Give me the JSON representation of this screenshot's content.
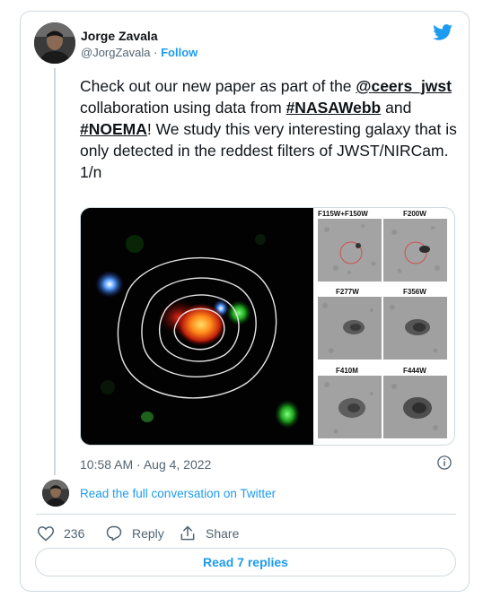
{
  "author": {
    "name": "Jorge Zavala",
    "handle": "@JorgZavala",
    "separator": "·",
    "follow_label": "Follow"
  },
  "tweet": {
    "text_1": "Check out our new paper as part of the ",
    "mention": "@ceers_jwst",
    "text_2": " collaboration using data from ",
    "hashtag_1": "#NASAWebb",
    "text_3": " and ",
    "hashtag_2": "#NOEMA",
    "text_4": "! We study this very interesting galaxy that is only detected in the reddest filters of JWST/NIRCam.",
    "counter": "1/n"
  },
  "media": {
    "filter_labels": [
      "F115W+F150W",
      "F200W",
      "F277W",
      "F356W",
      "F410M",
      "F444W"
    ]
  },
  "timestamp": "10:58 AM · Aug 4, 2022",
  "read_full": "Read the full conversation on Twitter",
  "actions": {
    "like_count": "236",
    "reply_label": "Reply",
    "share_label": "Share"
  },
  "read_replies": "Read 7 replies",
  "colors": {
    "accent": "#1d9bf0",
    "text": "#0f1419",
    "muted": "#536471",
    "border": "#cfd9de"
  }
}
